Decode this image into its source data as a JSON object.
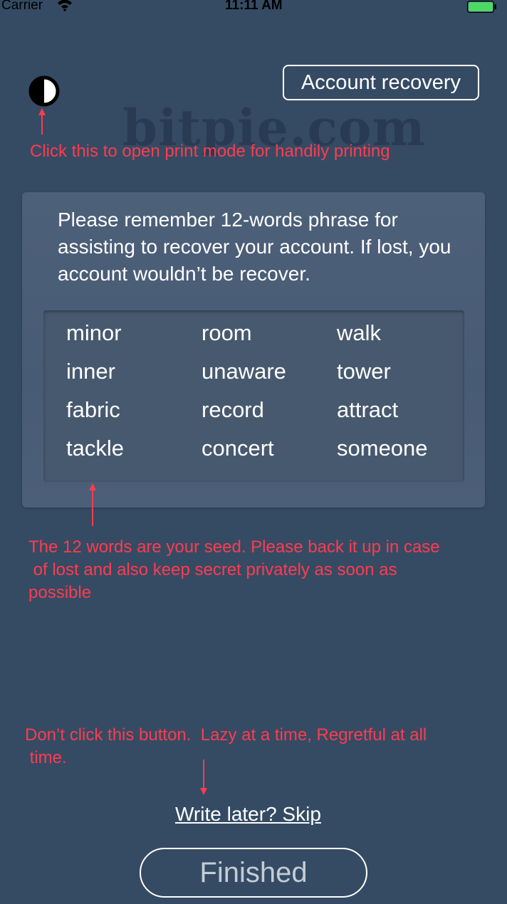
{
  "status_bar": {
    "carrier": "Carrier",
    "time": "11:11 AM",
    "wifi_icon": "wifi-icon",
    "battery_icon": "battery-icon",
    "battery_color": "#4cd964"
  },
  "header": {
    "print_mode_icon": "half-circle-contrast-icon",
    "account_recovery_label": "Account recovery",
    "watermark": "bitpie.com"
  },
  "annotations": {
    "print_hint": "Click this to open print mode for handily printing",
    "seed_hint_lines": [
      "The 12 words are your seed. Please back it up in case",
      " of lost and also keep secret privately as soon as",
      "possible"
    ],
    "skip_hint_lines": [
      "Don’t click this button.  Lazy at a time, Regretful at all",
      " time."
    ],
    "color": "#ff3b4e"
  },
  "seed_card": {
    "instructions": "Please remember 12-words phrase for assisting to recover your account. If lost, you account wouldn’t be recover.",
    "words": [
      "minor",
      "room",
      "walk",
      "inner",
      "unaware",
      "tower",
      "fabric",
      "record",
      "attract",
      "tackle",
      "concert",
      "someone"
    ]
  },
  "footer": {
    "skip_label": "Write later? Skip",
    "finished_label": "Finished"
  },
  "colors": {
    "background": "#354b64",
    "card": "#4b5e77"
  }
}
